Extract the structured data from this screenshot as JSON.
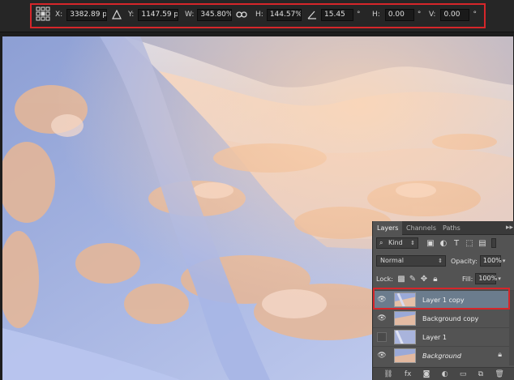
{
  "options_bar": {
    "x": {
      "label": "X:",
      "value": "3382.89 p"
    },
    "y": {
      "label": "Y:",
      "value": "1147.59 p"
    },
    "w": {
      "label": "W:",
      "value": "345.80%"
    },
    "h": {
      "label": "H:",
      "value": "144.57%"
    },
    "angle": {
      "value": "15.45",
      "unit": "°"
    },
    "skew_h": {
      "label": "H:",
      "value": "0.00",
      "unit": "°"
    },
    "skew_v": {
      "label": "V:",
      "value": "0.00",
      "unit": "°"
    },
    "icons": [
      "reference-point-grid-icon",
      "delta-icon",
      "link-icon",
      "angle-icon"
    ]
  },
  "layers_panel": {
    "tabs": [
      {
        "label": "Layers",
        "active": true
      },
      {
        "label": "Channels",
        "active": false
      },
      {
        "label": "Paths",
        "active": false
      }
    ],
    "menu_glyph": "▸▸",
    "filter": {
      "label": "Kind"
    },
    "blend_mode": "Normal",
    "opacity": {
      "label": "Opacity:",
      "value": "100%"
    },
    "lock": {
      "label": "Lock:"
    },
    "fill": {
      "label": "Fill:",
      "value": "100%"
    },
    "layers": [
      {
        "name": "Layer 1 copy",
        "visible": true,
        "selected": true,
        "italic": false,
        "locked": false
      },
      {
        "name": "Background copy",
        "visible": true,
        "selected": false,
        "italic": false,
        "locked": false
      },
      {
        "name": "Layer 1",
        "visible": false,
        "selected": false,
        "italic": false,
        "locked": false
      },
      {
        "name": "Background",
        "visible": true,
        "selected": false,
        "italic": true,
        "locked": true
      }
    ],
    "footer_icons": [
      "link-layers-icon",
      "fx-icon",
      "mask-icon",
      "adjustment-icon",
      "group-icon",
      "new-layer-icon",
      "trash-icon"
    ],
    "footer_glyphs": {
      "fx": "fx"
    }
  },
  "colors": {
    "highlight_red": "#d6262a",
    "selected_row": "#6b7c8d",
    "panel_bg": "#535353"
  }
}
